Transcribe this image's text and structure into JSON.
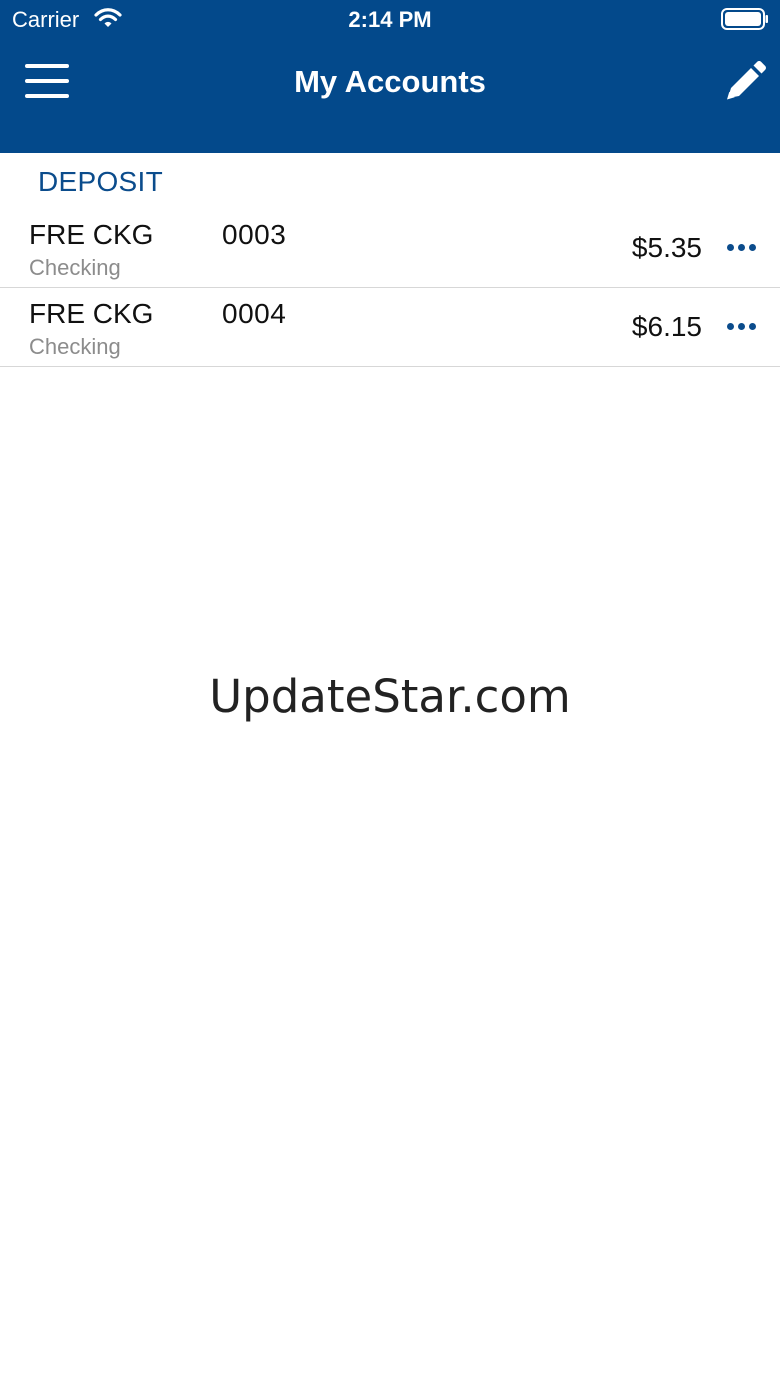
{
  "status_bar": {
    "carrier": "Carrier",
    "time": "2:14 PM",
    "wifi_icon": "wifi-icon",
    "battery_icon": "battery-icon"
  },
  "header": {
    "title": "My Accounts",
    "menu_icon": "hamburger-menu-icon",
    "edit_icon": "pencil-icon",
    "background_color": "#03498b"
  },
  "section": {
    "title": "DEPOSIT",
    "title_color": "#0b4c8c"
  },
  "accounts": [
    {
      "name": "FRE CKG",
      "type": "Checking",
      "number": "0003",
      "balance": "$5.35",
      "more_icon": "more-dots-icon"
    },
    {
      "name": "FRE CKG",
      "type": "Checking",
      "number": "0004",
      "balance": "$6.15",
      "more_icon": "more-dots-icon"
    }
  ],
  "watermark": "UpdateStar.com"
}
